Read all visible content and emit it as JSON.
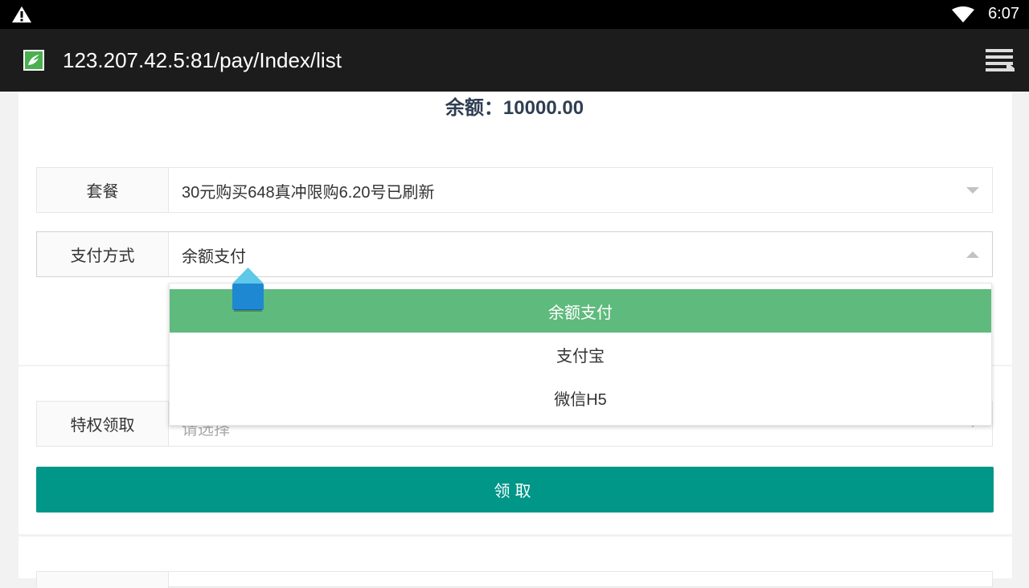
{
  "status_bar": {
    "time": "6:07",
    "warning_icon": "warning-icon",
    "wifi_icon": "wifi-icon"
  },
  "browser": {
    "url": "123.207.42.5:81/pay/Index/list",
    "site_icon": "site-favicon",
    "menu_icon": "tabs-menu-icon"
  },
  "balance": {
    "text": "余额：10000.00"
  },
  "package": {
    "label": "套餐",
    "value": "30元购买648真冲限购6.20号已刷新"
  },
  "payment": {
    "label": "支付方式",
    "value": "余额支付",
    "options": [
      "余额支付",
      "支付宝",
      "微信H5"
    ],
    "selected_index": 0
  },
  "privilege": {
    "label": "特权领取",
    "placeholder": "请选择"
  },
  "claim_button": {
    "label": "领取"
  },
  "colors": {
    "selected_option": "#5fba7d",
    "claim_button": "#009688",
    "balance_text": "#2f3e52"
  }
}
